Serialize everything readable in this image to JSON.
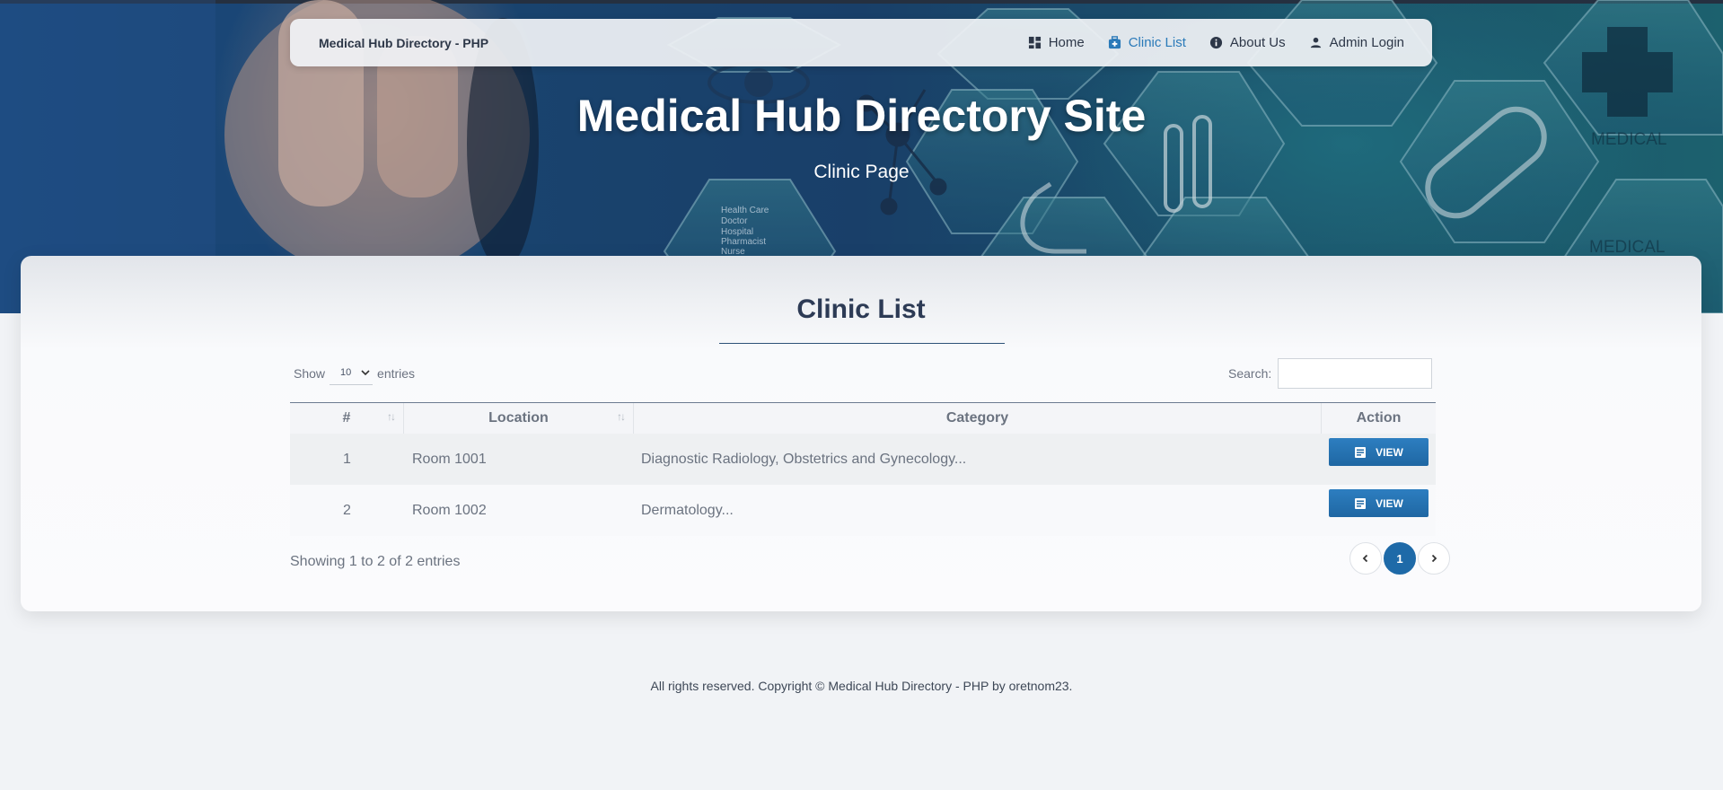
{
  "navbar": {
    "brand": "Medical Hub Directory - PHP",
    "items": [
      {
        "label": "Home",
        "icon": "dashboard-icon"
      },
      {
        "label": "Clinic List",
        "icon": "medical-bag-icon",
        "active": true
      },
      {
        "label": "About Us",
        "icon": "info-icon"
      },
      {
        "label": "Admin Login",
        "icon": "user-icon"
      }
    ]
  },
  "hero": {
    "title": "Medical Hub Directory Site",
    "subtitle": "Clinic Page",
    "background_words": [
      "Health Care",
      "Doctor",
      "Hospital",
      "Pharmacist",
      "Nurse",
      "MEDICAL",
      "MEDICAL"
    ]
  },
  "card": {
    "title": "Clinic List",
    "length_label_before": "Show",
    "length_value": "10",
    "length_label_after": "entries",
    "search_label": "Search:",
    "search_value": ""
  },
  "table": {
    "columns": [
      "#",
      "Location",
      "Category",
      "Action"
    ],
    "rows": [
      {
        "num": "1",
        "location": "Room 1001",
        "category": "Diagnostic Radiology, Obstetrics and Gynecology...",
        "action": "VIEW"
      },
      {
        "num": "2",
        "location": "Room 1002",
        "category": "Dermatology...",
        "action": "VIEW"
      }
    ],
    "info": "Showing 1 to 2 of 2 entries",
    "current_page": "1"
  },
  "footer": {
    "text": "All rights reserved. Copyright © Medical Hub Directory - PHP by oretnom23."
  },
  "colors": {
    "accent": "#1e6aa8",
    "nav_active": "#2a7ab9",
    "heading": "#2d3b55"
  }
}
